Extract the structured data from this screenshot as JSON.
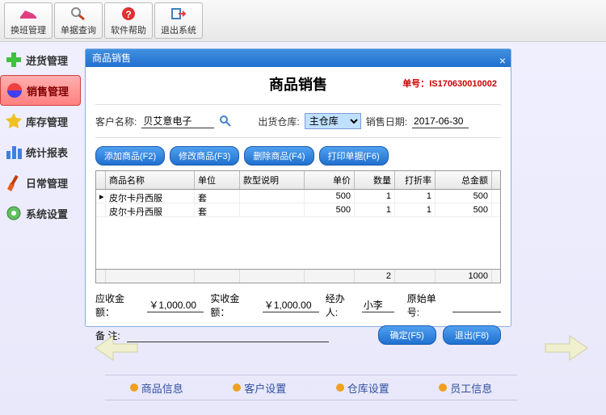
{
  "toolbar": {
    "shift": "换班管理",
    "query": "单据查询",
    "help": "软件帮助",
    "exit": "退出系统"
  },
  "sidebar": {
    "items": [
      {
        "label": "进货管理"
      },
      {
        "label": "销售管理"
      },
      {
        "label": "库存管理"
      },
      {
        "label": "统计报表"
      },
      {
        "label": "日常管理"
      },
      {
        "label": "系统设置"
      }
    ]
  },
  "dialog": {
    "window_title": "商品销售",
    "title": "商品销售",
    "order_no_label": "单号：",
    "order_no": "IS170630010002",
    "customer_label": "客户名称:",
    "customer": "贝艾意电子",
    "warehouse_label": "出货仓库:",
    "warehouse": "主仓库",
    "date_label": "销售日期:",
    "date": "2017-06-30",
    "buttons": {
      "add": "添加商品(F2)",
      "edit": "修改商品(F3)",
      "delete": "删除商品(F4)",
      "print": "打印单据(F6)"
    },
    "columns": {
      "name": "商品名称",
      "unit": "单位",
      "model": "款型说明",
      "price": "单价",
      "qty": "数量",
      "discount": "打折率",
      "total": "总金额"
    },
    "rows": [
      {
        "name": "皮尔卡丹西服",
        "unit": "套",
        "model": "",
        "price": "500",
        "qty": "1",
        "discount": "1",
        "total": "500"
      },
      {
        "name": "皮尔卡丹西服",
        "unit": "套",
        "model": "",
        "price": "500",
        "qty": "1",
        "discount": "1",
        "total": "500"
      }
    ],
    "footer": {
      "qty": "2",
      "total": "1000"
    },
    "receivable_label": "应收金额：",
    "receivable": "￥1,000.00",
    "actual_label": "实收金额：",
    "actual": "￥1,000.00",
    "operator_label": "经办人:",
    "operator": "小李",
    "original_no_label": "原始单号:",
    "original_no": "",
    "remark_label": "备   注:",
    "remark": "",
    "confirm": "确定(F5)",
    "exit": "退出(F8)"
  },
  "bottom": {
    "product": "商品信息",
    "customer": "客户设置",
    "warehouse": "仓库设置",
    "staff": "员工信息"
  }
}
